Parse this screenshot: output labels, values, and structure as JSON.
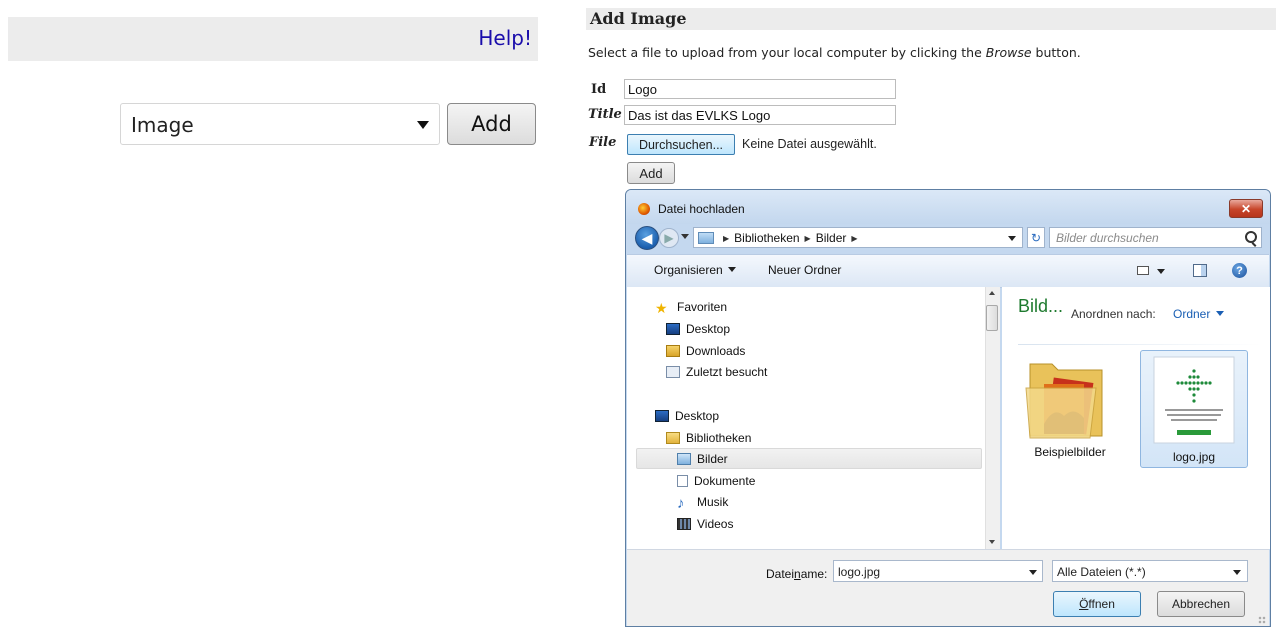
{
  "left_panel": {
    "help_link": "Help!",
    "type_select": {
      "value": "Image"
    },
    "add_button": "Add"
  },
  "form": {
    "section_title": "Add Image",
    "intro_before": "Select a file to upload from your local computer by clicking the ",
    "intro_em": "Browse",
    "intro_after": " button.",
    "id_label": "Id",
    "id_value": "Logo",
    "title_label": "Title",
    "title_value": "Das ist das EVLKS Logo",
    "file_label": "File",
    "browse_button": "Durchsuchen...",
    "no_file_text": "Keine Datei ausgewählt.",
    "add_button": "Add"
  },
  "dialog": {
    "title": "Datei hochladen",
    "close_label": "x",
    "breadcrumbs": [
      "Bibliotheken",
      "Bilder"
    ],
    "search_placeholder": "Bilder durchsuchen",
    "toolbar": {
      "organize": "Organisieren",
      "new_folder": "Neuer Ordner"
    },
    "nav": {
      "favorites_header": "Favoriten",
      "favorites": [
        "Desktop",
        "Downloads",
        "Zuletzt besucht"
      ],
      "desktop": "Desktop",
      "libraries": "Bibliotheken",
      "library_items": [
        "Bilder",
        "Dokumente",
        "Musik",
        "Videos"
      ],
      "selected": "Bilder"
    },
    "content": {
      "library_title": "Bild...",
      "sort_label": "Anordnen nach:",
      "sort_value": "Ordner",
      "files": [
        {
          "name": "Beispielbilder",
          "type": "folder",
          "selected": false
        },
        {
          "name": "logo.jpg",
          "type": "image",
          "selected": true
        }
      ]
    },
    "filename_label_pre": "Datei",
    "filename_label_u": "n",
    "filename_label_post": "ame:",
    "filename_value": "logo.jpg",
    "filetype_value": "Alle Dateien (*.*)",
    "open_label_u": "Ö",
    "open_label_rest": "ffnen",
    "cancel_label": "Abbrechen"
  },
  "colors": {
    "link": "#1a0dab",
    "library_title": "#1e7a2e",
    "sort_value": "#1a5fb4",
    "dialog_frame": "#c4d8ef"
  },
  "icons": [
    "firefox-icon",
    "close-icon",
    "back-icon",
    "forward-icon",
    "refresh-icon",
    "search-icon",
    "star-icon",
    "desktop-icon",
    "downloads-icon",
    "recent-icon",
    "library-icon",
    "pictures-icon",
    "documents-icon",
    "music-icon",
    "videos-icon",
    "folder-icon",
    "help-icon"
  ]
}
